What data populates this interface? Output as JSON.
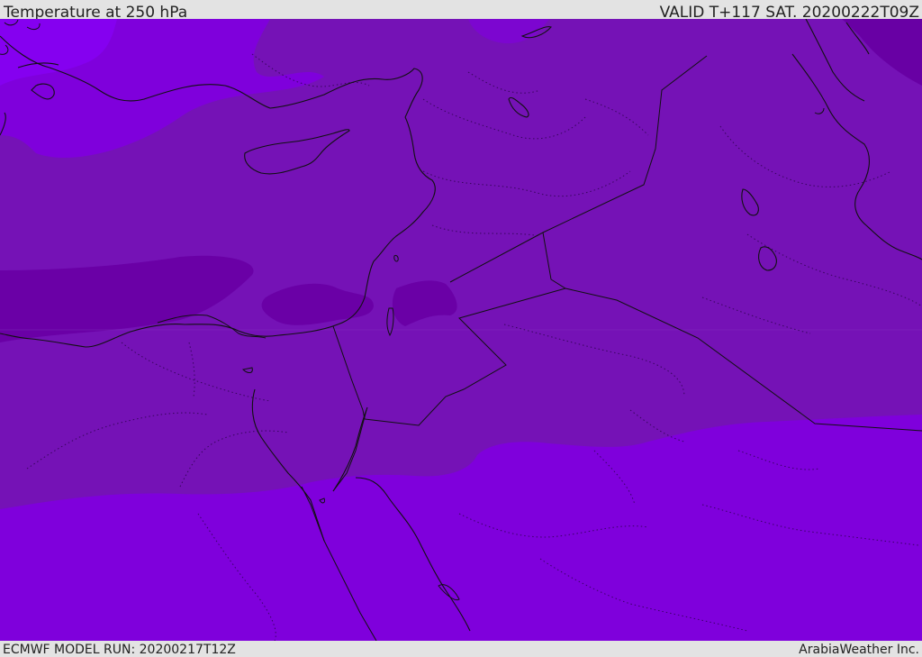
{
  "header": {
    "title": "Temperature at 250 hPa",
    "valid_time": "VALID T+117 SAT. 20200222T09Z"
  },
  "footer": {
    "model_run": "ECMWF MODEL RUN: 20200217T12Z",
    "credit": "ArabiaWeather Inc."
  },
  "colors": {
    "band_cold": "#6a00a8",
    "band_mid": "#7512b6",
    "band_warm": "#7f00d8",
    "band_warmer": "#8000ee",
    "coastline": "#111111",
    "bar_background": "#e3e3e3"
  }
}
